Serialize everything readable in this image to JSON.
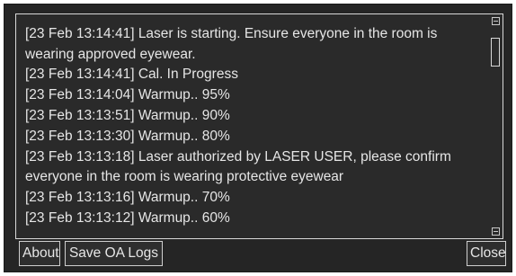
{
  "log": {
    "lines": [
      "[23 Feb 13:14:41] Laser is starting.  Ensure everyone in the room is wearing approved eyewear.",
      "[23 Feb 13:14:41] Laser is starting.  Ensure everyone in the room is wearing approved eyewear.",
      "[23 Feb 13:14:41] Cal. In Progress",
      "[23 Feb 13:14:04] Warmup.. 95%",
      "[23 Feb 13:13:51] Warmup.. 90%",
      "[23 Feb 13:13:30] Warmup.. 80%",
      "[23 Feb 13:13:18] Laser authorized by LASER USER, please confirm everyone in the room is wearing protective eyewear",
      "[23 Feb 13:13:16] Warmup.. 70%",
      "[23 Feb 13:13:12] Warmup.. 60%"
    ]
  },
  "buttons": {
    "about": "About",
    "save_logs": "Save OA Logs",
    "close": "Close"
  }
}
